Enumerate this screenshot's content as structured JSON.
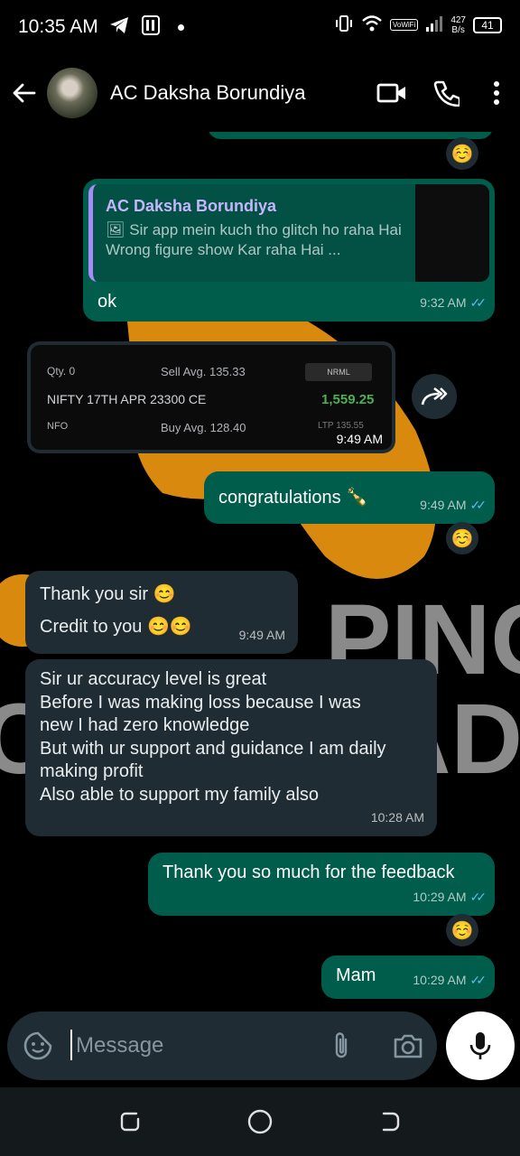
{
  "status_bar": {
    "time": "10:35 AM",
    "vowifi": "VoWiFi",
    "net_speed_value": "427",
    "net_speed_unit": "B/s",
    "battery": "41"
  },
  "header": {
    "contact_name": "AC Daksha Borundiya"
  },
  "messages": {
    "m1": {
      "quote_name": "AC Daksha Borundiya",
      "quote_line1": "🖼 Sir app mein kuch tho glitch ho raha Hai",
      "quote_line2": "Wrong figure show Kar raha Hai ...",
      "text": "ok",
      "time": "9:32 AM"
    },
    "m2": {
      "qty": "Qty. 0",
      "sell_avg": "Sell Avg. 135.33",
      "product": "NRML",
      "symbol": "NIFTY 17TH APR 23300 CE",
      "pnl": "1,559.25",
      "exchange": "NFO",
      "buy_avg": "Buy Avg. 128.40",
      "ltp": "LTP 135.55",
      "time": "9:49 AM"
    },
    "m3": {
      "text": "congratulations 🍾",
      "time": "9:49 AM"
    },
    "m4": {
      "line1": "Thank you sir 😊",
      "line2": "Credit to you 😊😊",
      "time": "9:49 AM"
    },
    "m5": {
      "line1": "Sir ur accuracy level is great",
      "line2": "Before I was making loss  because I was",
      "line3": "new I had zero knowledge",
      "line4": "But with ur support and guidance I am daily",
      "line5": "making profit",
      "line6": "Also able to support my family also",
      "time": "10:28 AM"
    },
    "m6": {
      "text": "Thank you so much for the feedback",
      "time": "10:29 AM"
    },
    "m7": {
      "text": "Mam",
      "time": "10:29 AM"
    },
    "reaction": "☺️",
    "ticks": "✓✓"
  },
  "wallpaper": {
    "text1": "PING",
    "text2": "ADE",
    "brand_color": "#d98a0e"
  },
  "input": {
    "placeholder": "Message"
  },
  "colors": {
    "outgoing_bubble": "#005c4b",
    "incoming_bubble": "#202c33",
    "read_ticks": "#53bdeb",
    "pnl_green": "#4caf50"
  }
}
